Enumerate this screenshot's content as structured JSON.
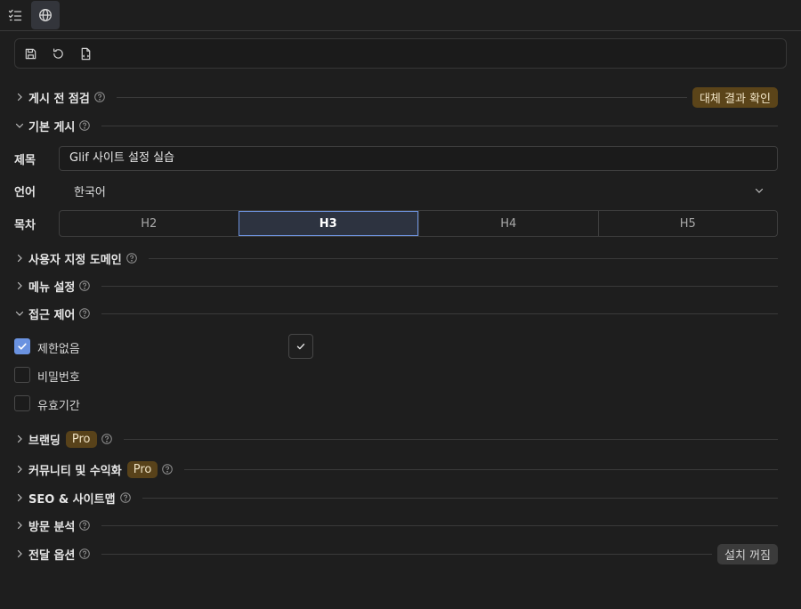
{
  "sections": {
    "prepublish": {
      "title": "게시 전 점검",
      "action": "대체 결과 확인"
    },
    "basic": {
      "title": "기본 게시"
    },
    "domain": {
      "title": "사용자 지정 도메인"
    },
    "menu": {
      "title": "메뉴 설정"
    },
    "access": {
      "title": "접근 제어"
    },
    "branding": {
      "title": "브랜딩",
      "badge": "Pro"
    },
    "community": {
      "title": "커뮤니티 및 수익화",
      "badge": "Pro"
    },
    "seo": {
      "title": "SEO & 사이트맵"
    },
    "analytics": {
      "title": "방문 분석"
    },
    "delivery": {
      "title": "전달 옵션",
      "status": "설치 꺼짐"
    }
  },
  "form": {
    "title_label": "제목",
    "title_value": "Glif 사이트 설정 실습",
    "language_label": "언어",
    "language_value": "한국어",
    "toc_label": "목차",
    "toc_options": [
      "H2",
      "H3",
      "H4",
      "H5"
    ],
    "toc_selected": "H3"
  },
  "access": {
    "options": [
      {
        "label": "제한없음",
        "checked": true
      },
      {
        "label": "비밀번호",
        "checked": false
      },
      {
        "label": "유효기간",
        "checked": false
      }
    ]
  },
  "icons": {
    "tabs": [
      "checklist-icon",
      "globe-icon"
    ],
    "toolbar": [
      "save-icon",
      "reset-icon",
      "export-file-icon"
    ]
  },
  "colors": {
    "accent": "#6a92e0",
    "pro_badge": "#58421a",
    "background": "#1e1e1e"
  }
}
